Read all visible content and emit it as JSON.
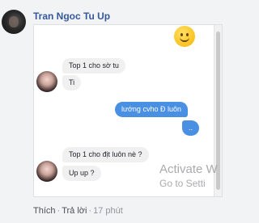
{
  "comment": {
    "author": "Tran Ngoc Tu Up",
    "actions": {
      "like": "Thích",
      "reply": "Trả lời",
      "separator": "·",
      "time": "17 phút"
    }
  },
  "chat": {
    "messages": [
      {
        "side": "in",
        "text": "Top 1 cho sờ tu"
      },
      {
        "side": "in",
        "text": "Ti"
      },
      {
        "side": "out",
        "text": "lướng cvho Đ luôn"
      },
      {
        "side": "out",
        "text": ".."
      },
      {
        "side": "in",
        "text": "Top 1 cho địt luôn nè ?"
      },
      {
        "side": "in",
        "text": "Up up ?"
      }
    ]
  },
  "watermark": {
    "line1": "Activate W",
    "line2": "Go to Setti"
  },
  "icons": [
    "user-avatar",
    "smiley-emoji-icon"
  ],
  "colors": {
    "author_link": "#365899",
    "outgoing_bubble": "#4a90e2",
    "incoming_bubble": "#f1f0f0",
    "page_background": "#f2f3f5"
  }
}
